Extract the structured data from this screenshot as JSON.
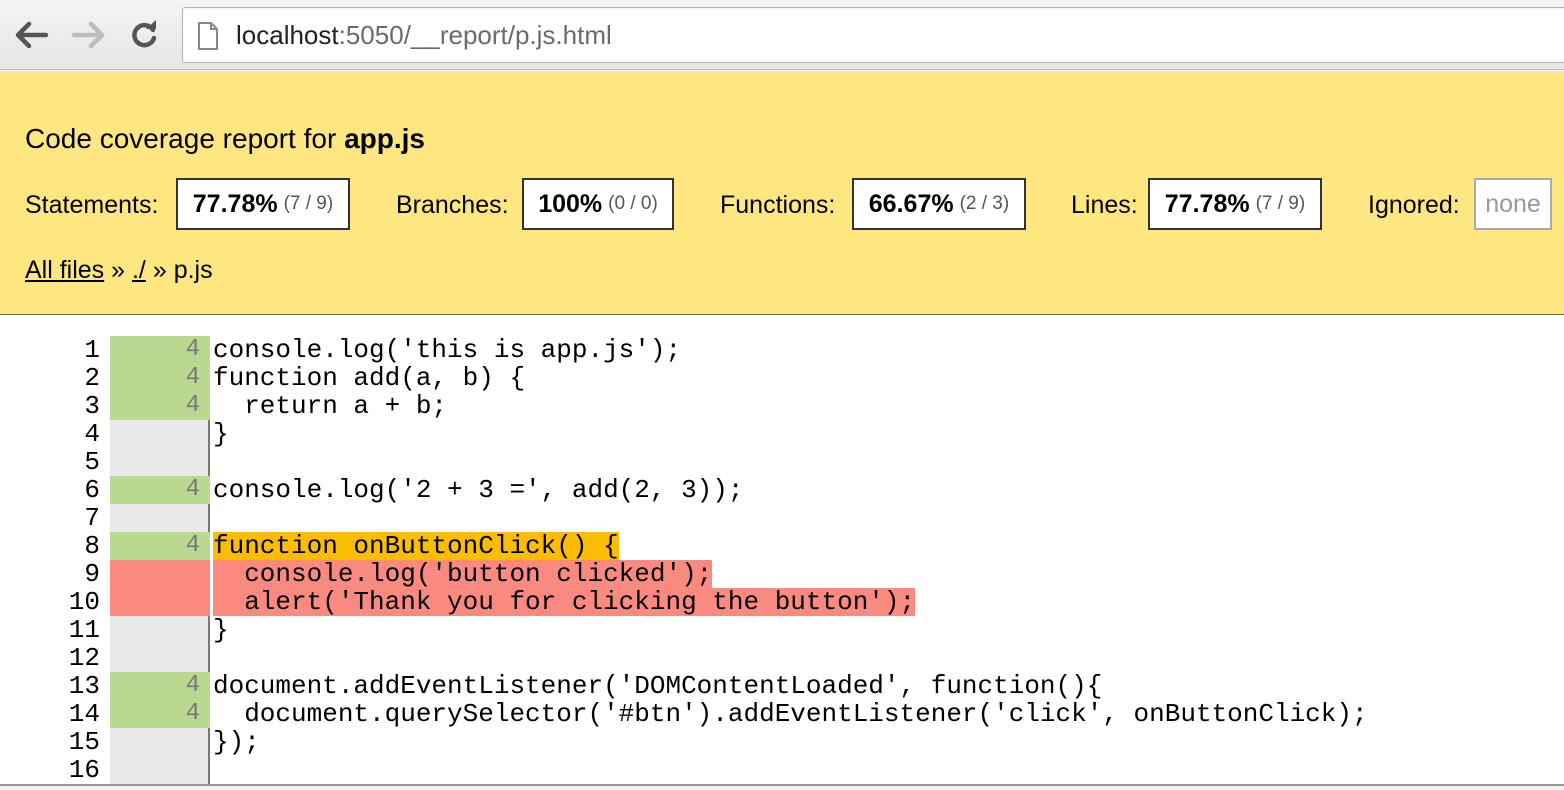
{
  "browser": {
    "url_host": "localhost",
    "url_rest": ":5050/__report/p.js.html"
  },
  "header": {
    "title_prefix": "Code coverage report for ",
    "title_file": "app.js",
    "stats": {
      "statements": {
        "label": "Statements:",
        "pct": "77.78%",
        "frac": "(7 / 9)"
      },
      "branches": {
        "label": "Branches:",
        "pct": "100%",
        "frac": "(0 / 0)"
      },
      "functions": {
        "label": "Functions:",
        "pct": "66.67%",
        "frac": "(2 / 3)"
      },
      "lines": {
        "label": "Lines:",
        "pct": "77.78%",
        "frac": "(7 / 9)"
      },
      "ignored": {
        "label": "Ignored:",
        "value": "none"
      }
    },
    "breadcrumb": {
      "all_files": "All files",
      "sep1": " » ",
      "dir": "./",
      "sep2": " » ",
      "file": "p.js"
    }
  },
  "code": {
    "lines": [
      {
        "n": "1",
        "hits": "4",
        "status": "covered",
        "text": "console.log('this is app.js');",
        "hl": ""
      },
      {
        "n": "2",
        "hits": "4",
        "status": "covered",
        "text": "function add(a, b) {",
        "hl": ""
      },
      {
        "n": "3",
        "hits": "4",
        "status": "covered",
        "text": "  return a + b;",
        "hl": ""
      },
      {
        "n": "4",
        "hits": "",
        "status": "neutral",
        "text": "}",
        "hl": ""
      },
      {
        "n": "5",
        "hits": "",
        "status": "neutral",
        "text": "",
        "hl": ""
      },
      {
        "n": "6",
        "hits": "4",
        "status": "covered",
        "text": "console.log('2 + 3 =', add(2, 3));",
        "hl": ""
      },
      {
        "n": "7",
        "hits": "",
        "status": "neutral",
        "text": "",
        "hl": ""
      },
      {
        "n": "8",
        "hits": "4",
        "status": "covered",
        "text": "function onButtonClick() {",
        "hl": "fn-miss"
      },
      {
        "n": "9",
        "hits": "",
        "status": "uncovered",
        "text": "  console.log('button clicked');",
        "hl": "st-miss"
      },
      {
        "n": "10",
        "hits": "",
        "status": "uncovered",
        "text": "  alert('Thank you for clicking the button');",
        "hl": "st-miss"
      },
      {
        "n": "11",
        "hits": "",
        "status": "neutral",
        "text": "}",
        "hl": ""
      },
      {
        "n": "12",
        "hits": "",
        "status": "neutral",
        "text": "",
        "hl": ""
      },
      {
        "n": "13",
        "hits": "4",
        "status": "covered",
        "text": "document.addEventListener('DOMContentLoaded', function(){",
        "hl": ""
      },
      {
        "n": "14",
        "hits": "4",
        "status": "covered",
        "text": "  document.querySelector('#btn').addEventListener('click', onButtonClick);",
        "hl": ""
      },
      {
        "n": "15",
        "hits": "",
        "status": "neutral",
        "text": "});",
        "hl": ""
      },
      {
        "n": "16",
        "hits": "",
        "status": "neutral",
        "text": "",
        "hl": ""
      }
    ]
  },
  "colors": {
    "header_bg": "#fee781",
    "covered": "#b8d98f",
    "uncovered": "#fa8a80",
    "function_missed": "#fcbd00"
  }
}
